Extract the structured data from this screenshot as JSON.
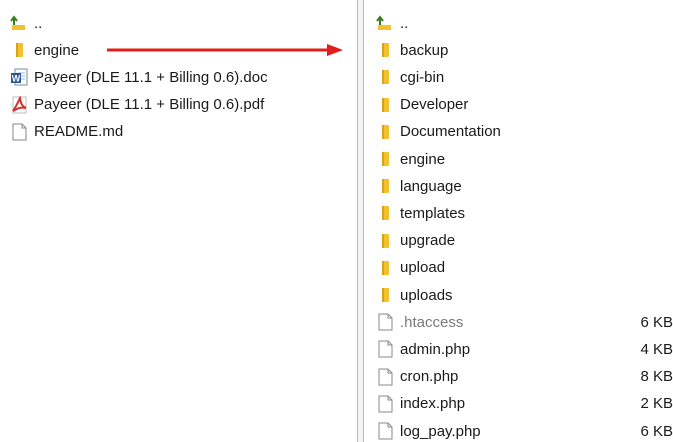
{
  "left_pane": {
    "items": [
      {
        "name": "..",
        "icon": "parent-folder-icon",
        "dotted": true
      },
      {
        "name": "engine",
        "icon": "folder-icon"
      },
      {
        "name": "Payeer (DLE 11.1 + Billing 0.6).doc",
        "icon": "word-document-icon"
      },
      {
        "name": "Payeer (DLE 11.1 + Billing 0.6).pdf",
        "icon": "pdf-document-icon"
      },
      {
        "name": "README.md",
        "icon": "file-icon"
      }
    ]
  },
  "right_pane": {
    "items": [
      {
        "name": "..",
        "icon": "parent-folder-icon",
        "size": ""
      },
      {
        "name": "backup",
        "icon": "folder-icon",
        "size": ""
      },
      {
        "name": "cgi-bin",
        "icon": "folder-icon",
        "size": ""
      },
      {
        "name": "Developer",
        "icon": "folder-icon",
        "size": ""
      },
      {
        "name": "Documentation",
        "icon": "folder-icon",
        "size": ""
      },
      {
        "name": "engine",
        "icon": "folder-icon",
        "size": ""
      },
      {
        "name": "language",
        "icon": "folder-icon",
        "size": ""
      },
      {
        "name": "templates",
        "icon": "folder-icon",
        "size": ""
      },
      {
        "name": "upgrade",
        "icon": "folder-icon",
        "size": ""
      },
      {
        "name": "upload",
        "icon": "folder-icon",
        "size": ""
      },
      {
        "name": "uploads",
        "icon": "folder-icon",
        "size": ""
      },
      {
        "name": ".htaccess",
        "icon": "file-icon",
        "size": "6 KB",
        "hidden": true
      },
      {
        "name": "admin.php",
        "icon": "file-icon",
        "size": "4 KB"
      },
      {
        "name": "cron.php",
        "icon": "file-icon",
        "size": "8 KB"
      },
      {
        "name": "index.php",
        "icon": "file-icon",
        "size": "2 KB"
      },
      {
        "name": "log_pay.php",
        "icon": "file-icon",
        "size": "6 KB"
      }
    ]
  },
  "colors": {
    "folder": "#f2c12e",
    "parent_arrow": "#3a7d1e",
    "word_blue": "#2b5797",
    "pdf_red": "#d4322c",
    "annotation_arrow": "#e51c1c"
  }
}
